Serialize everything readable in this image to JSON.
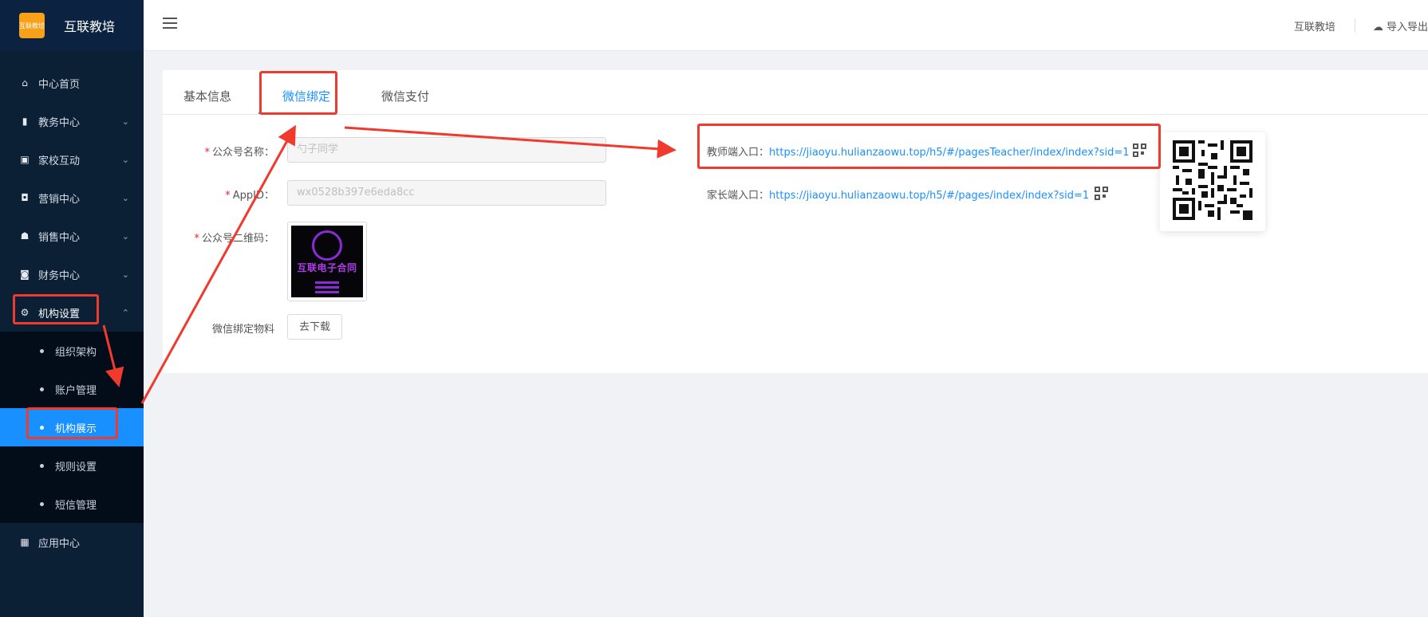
{
  "brand": {
    "name": "互联教培",
    "logo_text": "互联教培"
  },
  "nav": {
    "items": [
      {
        "label": "中心首页",
        "icon": "home-icon",
        "glyph": "⌂"
      },
      {
        "label": "教务中心",
        "icon": "book-icon",
        "glyph": "▮"
      },
      {
        "label": "家校互动",
        "icon": "chat-icon",
        "glyph": "▣"
      },
      {
        "label": "营销中心",
        "icon": "bag-icon",
        "glyph": "◘"
      },
      {
        "label": "销售中心",
        "icon": "user-icon",
        "glyph": "☗"
      },
      {
        "label": "财务中心",
        "icon": "wallet-icon",
        "glyph": "◙"
      },
      {
        "label": "机构设置",
        "icon": "gear-icon",
        "glyph": "⚙"
      }
    ],
    "sub_items": [
      "组织架构",
      "账户管理",
      "机构展示",
      "规则设置",
      "短信管理"
    ],
    "last_item": {
      "label": "应用中心",
      "icon": "grid-icon",
      "glyph": "▦"
    }
  },
  "header": {
    "user": "互联教培",
    "export": "导入导出"
  },
  "tabs": [
    "基本信息",
    "微信绑定",
    "微信支付"
  ],
  "form": {
    "account_name": {
      "label": "公众号名称",
      "value": "勺子同学"
    },
    "appid": {
      "label": "AppID",
      "value": "wx0528b397e6eda8cc"
    },
    "qrcode": {
      "label": "公众号二维码",
      "image_text": "互联电子合同"
    },
    "material": {
      "label": "微信绑定物料",
      "button": "去下载"
    }
  },
  "entries": {
    "teacher": {
      "label": "教师端入口：",
      "url": "https://jiaoyu.hulianzaowu.top/h5/#/pagesTeacher/index/index?sid=1"
    },
    "parent": {
      "label": "家长端入口：",
      "url": "https://jiaoyu.hulianzaowu.top/h5/#/pages/index/index?sid=1"
    }
  },
  "colors": {
    "sidebar": "#0b1f35",
    "active": "#1890ff",
    "highlight": "#f03a2e"
  }
}
